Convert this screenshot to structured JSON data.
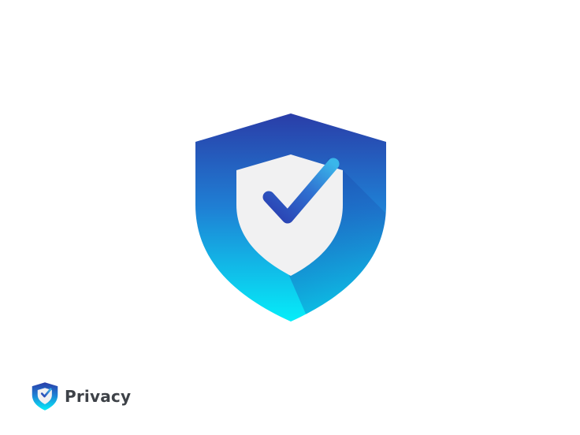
{
  "brand": {
    "name": "Privacy",
    "icon": "shield-check-icon"
  },
  "logo": {
    "icon": "shield-check-icon"
  },
  "colors": {
    "background": "#ffffff",
    "gradient_top": "#2a3da8",
    "gradient_mid": "#1f7fd4",
    "gradient_bottom": "#05eef9",
    "inner_shield": "#f1f1f2",
    "check_dark": "#2a3eb0",
    "check_light": "#3ab6ea",
    "text": "#3e4248"
  }
}
